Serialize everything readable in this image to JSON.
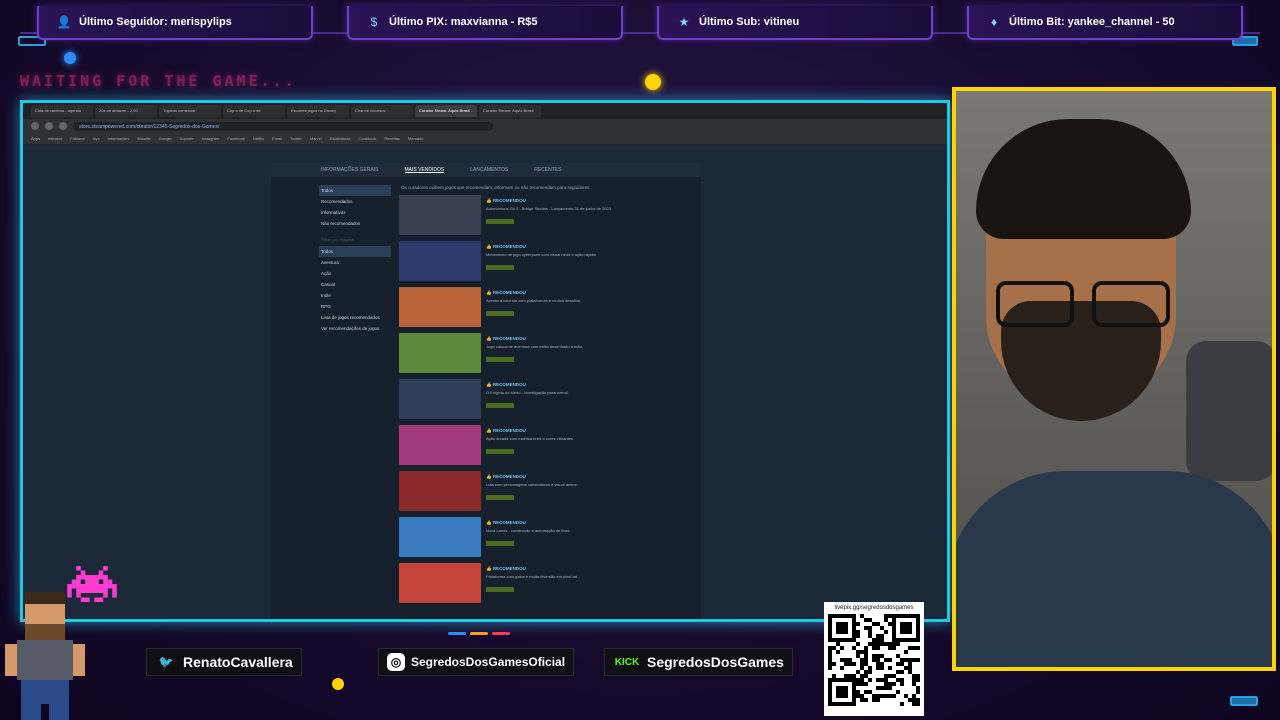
{
  "alerts": {
    "follower": {
      "icon": "person-icon",
      "text": "Último Seguidor: merispylips"
    },
    "pix": {
      "icon": "dollar-icon",
      "text": "Último PIX: maxvianna - R$5"
    },
    "sub": {
      "icon": "star-icon",
      "text": "Último Sub: vitineu"
    },
    "bit": {
      "icon": "gem-icon",
      "text": "Último Bit: yankee_channel - 50"
    }
  },
  "overlay": {
    "waiting": "WAITING FOR THE GAME..."
  },
  "browser": {
    "tabs": [
      "Cida de caverna - agenda",
      "20x de amazon - 2,00",
      "Tópicos comercial",
      "Cop a de Cop a de",
      "Escanea jogos no Disney",
      "Chat de recursos",
      "Curador Steam: Aquio Brasil",
      "Curador Steam: Aquio Brasil"
    ],
    "active_tab": 6,
    "url": "store.steampowered.com/curator/12345-Segredos-dos-Games/",
    "bookmarks": [
      "Apps",
      "estudos",
      "Fabiana",
      "Nyx",
      "Informações",
      "Moodle",
      "Google",
      "Suporte",
      "Instagram",
      "Facebook",
      "Netflix",
      "Email",
      "Twitter",
      "Marvel",
      "Estatísticas",
      "Cookbook",
      "Receitas",
      "Mercado"
    ]
  },
  "steam": {
    "tabs": [
      "INFORMAÇÕES GERAIS",
      "MAIS VENDIDOS",
      "LANÇAMENTOS",
      "RECENTES"
    ],
    "selected_tab": 1,
    "filters_top": [
      "Todos",
      "Recomendados",
      "Informativos",
      "Não recomendados"
    ],
    "filters_section": "Filtrar por etiqueta",
    "filters_tags": [
      "Todos",
      "Aventura",
      "Ação",
      "Casual",
      "Indie",
      "RPG"
    ],
    "filters_bottom": [
      "Lista de jogos recomendados",
      "Ver recomendações de jogos"
    ],
    "intro": "Os curadores exibem jogos que recomendam, informam ou não recomendam para seguidores.",
    "items": [
      {
        "label": "RECOMENDOU",
        "desc": "Autonomous Go 2 - Bridge Studios - Lançamento 31 de junho de 2023",
        "color": "#3a4150"
      },
      {
        "label": "RECOMENDOU",
        "desc": "Mecanismo de jogo cyberpunk com visual neon e ação rápida.",
        "color": "#2b3a6a"
      },
      {
        "label": "RECOMENDOU",
        "desc": "Aventura colorida com plataformas e muitos desafios.",
        "color": "#b9623a"
      },
      {
        "label": "RECOMENDOU",
        "desc": "Jogo casual de aventura com estilo desenhado à mão.",
        "color": "#5a8a3a"
      },
      {
        "label": "RECOMENDOU",
        "desc": "O Enigma do Medo - investigação paranormal.",
        "color": "#2f3d5a"
      },
      {
        "label": "RECOMENDOU",
        "desc": "Ação arcade com estética retrô e cores vibrantes.",
        "color": "#a03a7a"
      },
      {
        "label": "RECOMENDOU",
        "desc": "Luta com personagens carismáticos e visual anime.",
        "color": "#8a2a2a"
      },
      {
        "label": "RECOMENDOU",
        "desc": "Nova Lands - construção e automação de ilhas.",
        "color": "#3a7abf"
      },
      {
        "label": "RECOMENDOU",
        "desc": "Plataforma com gatos e muita diversão em pixel art.",
        "color": "#c4443a"
      }
    ]
  },
  "socials": {
    "twitter": {
      "icon": "twitter-icon",
      "handle": "RenatoCavallera"
    },
    "instagram": {
      "icon": "instagram-icon",
      "handle": "SegredosDosGamesOficial"
    },
    "kick": {
      "icon": "kick-icon",
      "badge": "KICK",
      "handle": "SegredosDosGames"
    }
  },
  "qr": {
    "label": "livepix.gg/segredosdosgames"
  },
  "colors": {
    "frame": "#23c7e6",
    "cam_border": "#ffd400",
    "alert_border": "#6d42c8",
    "waiting": "#ff3c8a",
    "steam_link": "#66c0f4"
  }
}
